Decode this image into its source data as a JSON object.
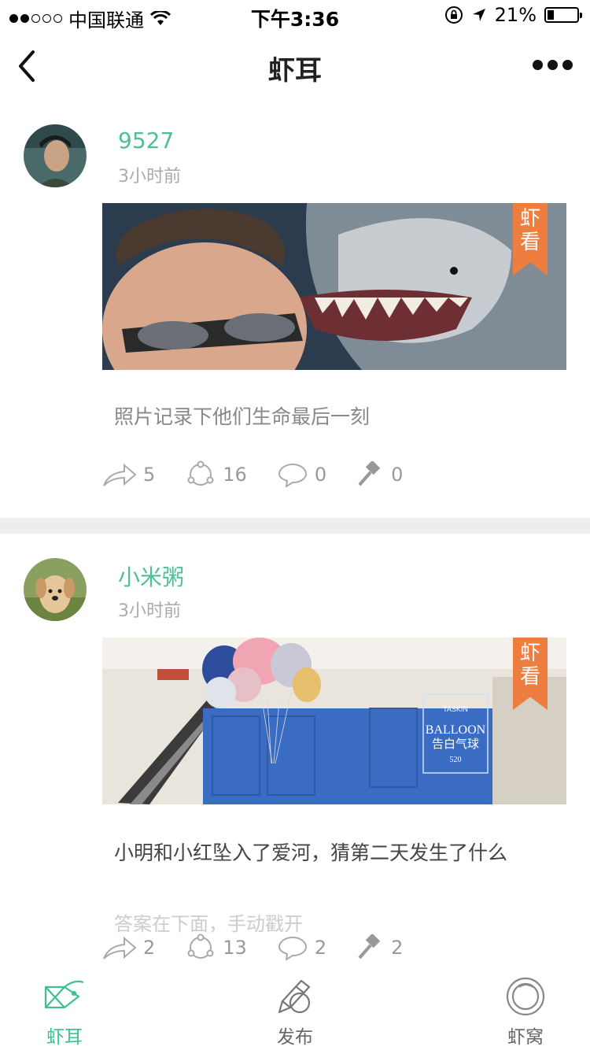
{
  "status_bar": {
    "carrier": "中国联通",
    "time": "下午3:36",
    "battery": "21%",
    "battery_level": 0.21
  },
  "nav": {
    "title": "虾耳",
    "back_icon": "chevron-left-icon",
    "more_icon": "more-dots-icon"
  },
  "badge": {
    "line1": "虾",
    "line2": "看"
  },
  "posts": [
    {
      "username": "9527",
      "time": "3小时前",
      "text": "照片记录下他们生命最后一刻",
      "extra": "",
      "forward": "5",
      "likes": "16",
      "comments": "0",
      "hammer": "0"
    },
    {
      "username": "小米粥",
      "time": "3小时前",
      "text": "小明和小红坠入了爱河，猜第二天发生了什么",
      "extra": "答案在下面，手动戳开",
      "forward": "2",
      "likes": "13",
      "comments": "2",
      "hammer": "2",
      "image_caption": {
        "brand": "TASKIN",
        "title": "BALLOON",
        "subtitle": "告白气球",
        "number": "520"
      }
    }
  ],
  "tabbar": {
    "tabs": [
      {
        "label": "虾耳",
        "icon": "shrimp-fish-icon",
        "active": true
      },
      {
        "label": "发布",
        "icon": "pen-icon",
        "active": false
      },
      {
        "label": "虾窝",
        "icon": "circle-nest-icon",
        "active": false
      }
    ]
  },
  "colors": {
    "accent": "#3fbf96",
    "username": "#4fbf99",
    "ribbon": "#ee7d40",
    "separator": "#ededed"
  }
}
